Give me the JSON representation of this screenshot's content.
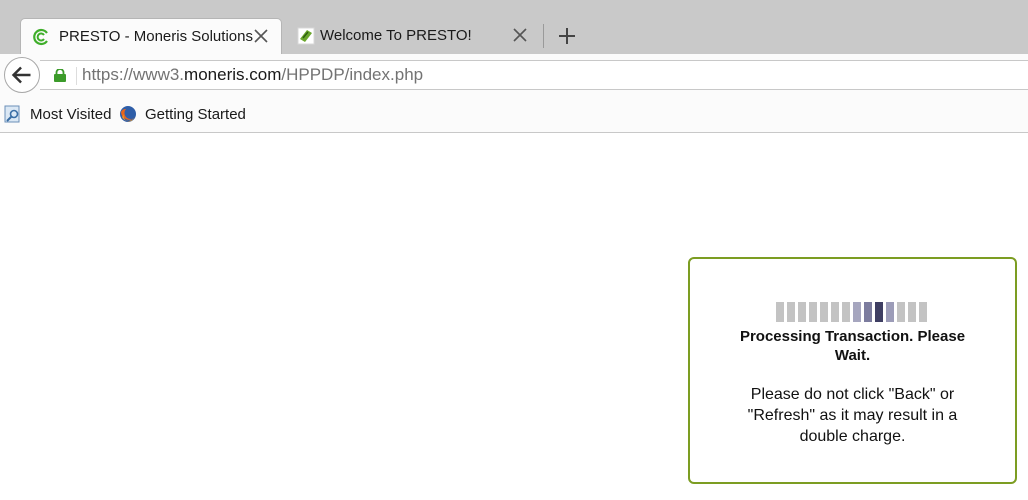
{
  "tabs": [
    {
      "title": "PRESTO - Moneris Solutions",
      "active": true,
      "icon": "moneris-icon"
    },
    {
      "title": "Welcome To PRESTO!",
      "active": false,
      "icon": "presto-icon"
    }
  ],
  "navbar": {
    "url_prefix": "https://www3.",
    "url_host": "moneris.com",
    "url_path": "/HPPDP/index.php"
  },
  "bookmarks": [
    {
      "label": "Most Visited",
      "icon": "most-visited-icon"
    },
    {
      "label": "Getting Started",
      "icon": "firefox-icon"
    }
  ],
  "modal": {
    "title": "Processing Transaction. Please Wait.",
    "warning": "Please do not click \"Back\" or \"Refresh\" as it may result in a double charge.",
    "loader_colors": [
      "#c3c3c3",
      "#c3c3c3",
      "#c3c3c3",
      "#c3c3c3",
      "#c3c3c3",
      "#c3c3c3",
      "#c3c3c3",
      "#a6a6bf",
      "#7c7c9e",
      "#3e3e62",
      "#9c9cb8",
      "#c3c3c3",
      "#c3c3c3",
      "#c3c3c3"
    ],
    "border_color": "#7c9d22"
  }
}
